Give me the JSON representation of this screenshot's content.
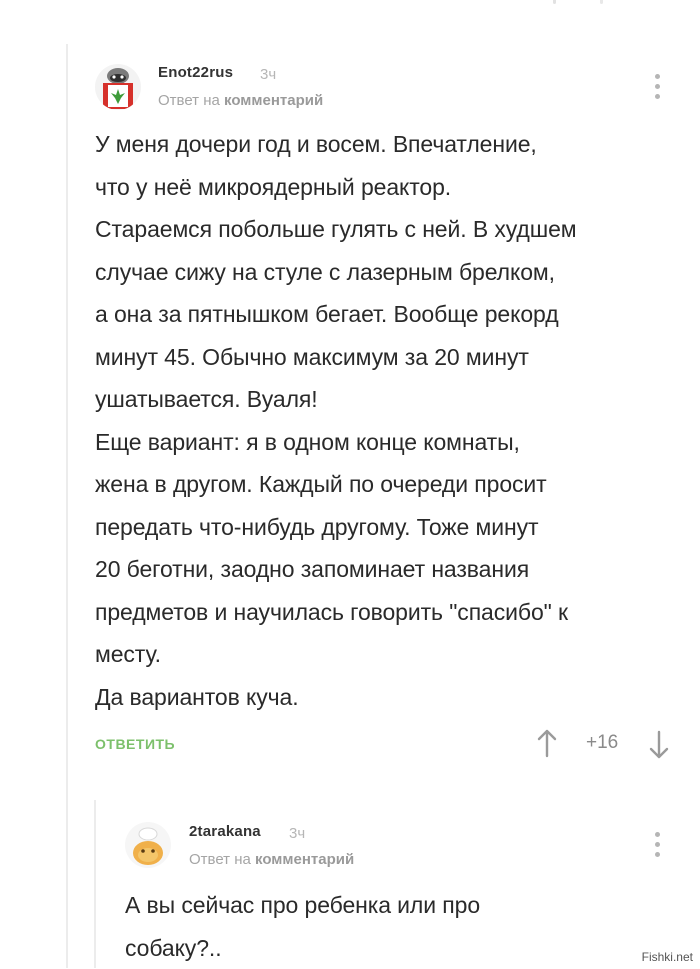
{
  "comments": [
    {
      "username": "Enot22rus",
      "time": "3ч",
      "reply_prefix": "Ответ на",
      "reply_target": "комментарий",
      "text": "У меня дочери год и восем. Впечатление,\nчто у неё микроядерный реактор.\nСтараемся побольше гулять с ней. В худшем\nслучае сижу на стуле с лазерным брелком,\nа она за пятнышком бегает. Вообще рекорд\nминут 45. Обычно максимум за 20 минут\nушатывается. Вуаля!\nЕще вариант: я в одном конце комнаты,\nжена в другом. Каждый по очереди просит\nпередать что-нибудь другому. Тоже минут\n20 беготни, заодно запоминает названия\nпредметов и научилась говорить \"спасибо\" к\nместу.\nДа вариантов куча.",
      "reply_label": "ОТВЕТИТЬ",
      "score": "+16"
    },
    {
      "username": "2tarakana",
      "time": "3ч",
      "reply_prefix": "Ответ на",
      "reply_target": "комментарий",
      "text": "А вы сейчас про ребенка или про\nсобаку?.."
    }
  ],
  "watermark": "Fishki.net",
  "colors": {
    "accent_green": "#7cc06b",
    "muted_gray": "#a5a5a5",
    "text": "#2a2a2a"
  },
  "icons": [
    "raccoon-avatar",
    "chef-avatar",
    "more-vertical-icon",
    "arrow-up-icon",
    "arrow-down-icon"
  ]
}
